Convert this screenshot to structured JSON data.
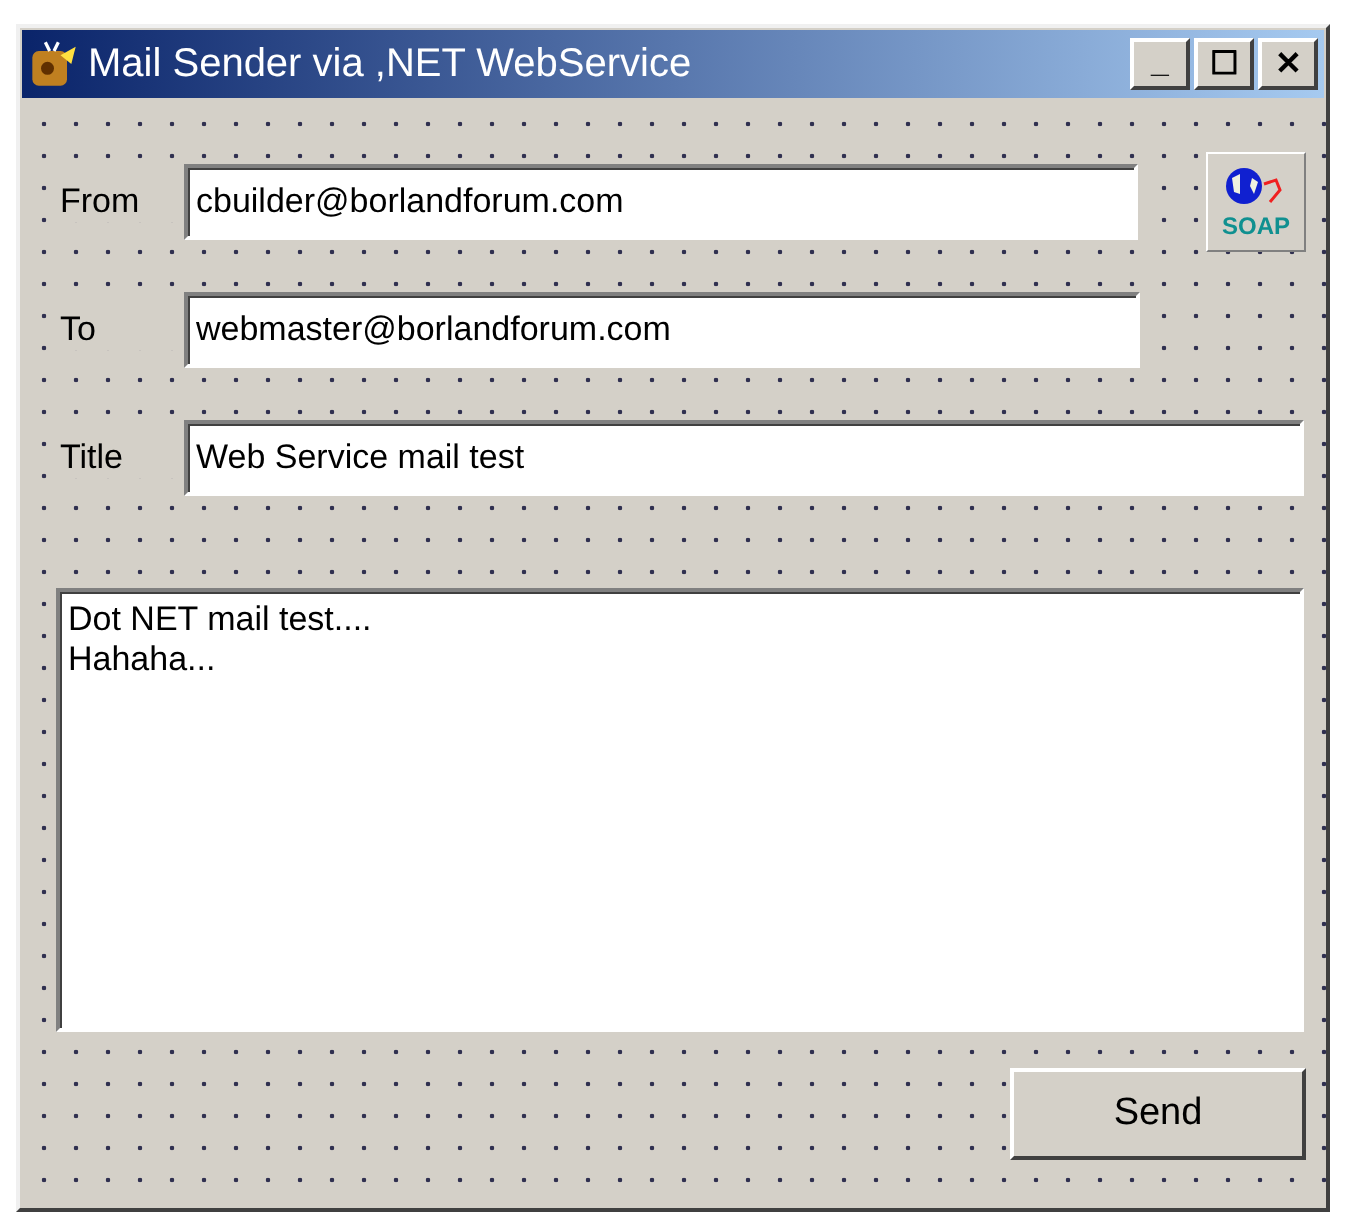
{
  "window": {
    "title": "Mail Sender via ,NET WebService",
    "controls": [
      "_",
      "☐",
      "✕"
    ]
  },
  "fields": [
    {
      "label": "From",
      "value": "cbuilder@borlandforum.com"
    },
    {
      "label": "To",
      "value": "webmaster@borlandforum.com"
    },
    {
      "label": "Title",
      "value": "Web Service mail test"
    }
  ],
  "soap_component": {
    "label": "SOAP"
  },
  "body": {
    "lines": [
      "Dot NET mail test....",
      "Hahaha..."
    ]
  },
  "buttons": [
    "Send"
  ]
}
